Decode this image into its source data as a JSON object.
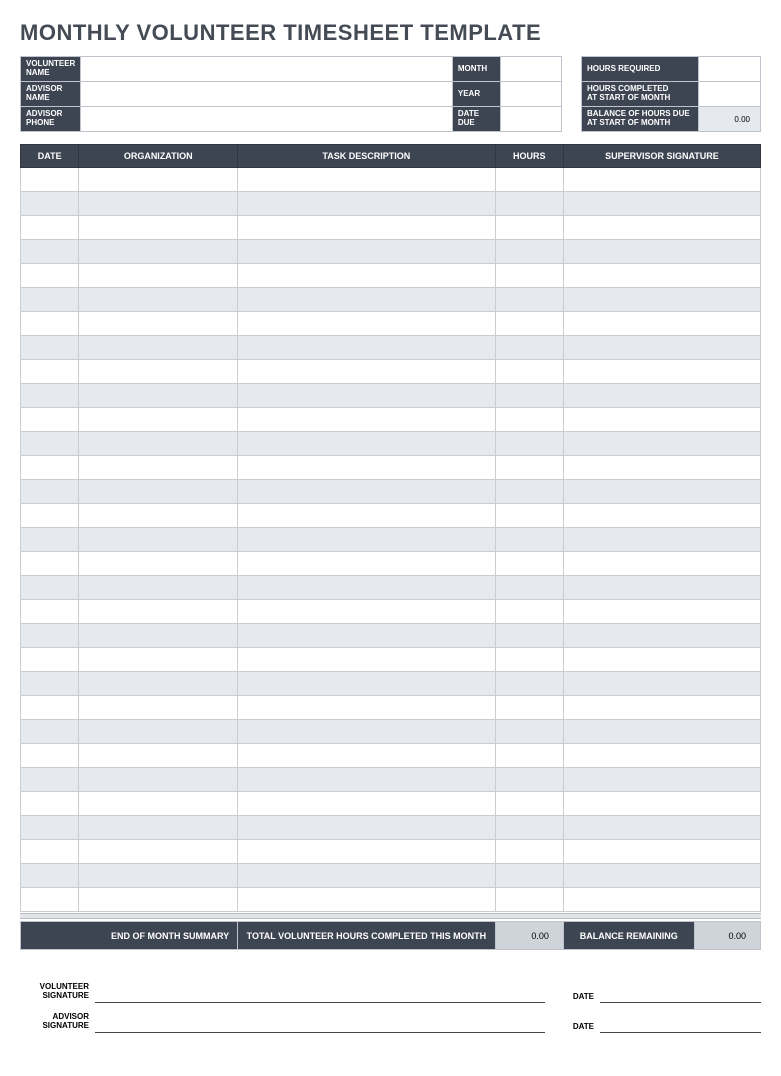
{
  "title": "MONTHLY VOLUNTEER TIMESHEET TEMPLATE",
  "info": {
    "volunteer_name_lbl": "VOLUNTEER NAME",
    "advisor_name_lbl": "ADVISOR NAME",
    "advisor_phone_lbl": "ADVISOR PHONE",
    "month_lbl": "MONTH",
    "year_lbl": "YEAR",
    "date_due_lbl": "DATE DUE",
    "hours_required_lbl": "HOURS REQUIRED",
    "hours_completed_lbl": "HOURS COMPLETED\nAT START OF MONTH",
    "balance_lbl": "BALANCE OF HOURS DUE\nAT START OF MONTH",
    "volunteer_name": "",
    "advisor_name": "",
    "advisor_phone": "",
    "month": "",
    "year": "",
    "date_due": "",
    "hours_required": "",
    "hours_completed": "",
    "balance": "0.00"
  },
  "columns": {
    "date": "DATE",
    "organization": "ORGANIZATION",
    "task": "TASK DESCRIPTION",
    "hours": "HOURS",
    "signature": "SUPERVISOR SIGNATURE"
  },
  "rows_count": 31,
  "summary": {
    "end_label": "END OF MONTH SUMMARY",
    "total_label": "TOTAL VOLUNTEER HOURS COMPLETED THIS MONTH",
    "total_value": "0.00",
    "balance_label": "BALANCE REMAINING",
    "balance_value": "0.00"
  },
  "sig": {
    "vol_lbl": "VOLUNTEER\nSIGNATURE",
    "adv_lbl": "ADVISOR\nSIGNATURE",
    "date_lbl": "DATE"
  }
}
